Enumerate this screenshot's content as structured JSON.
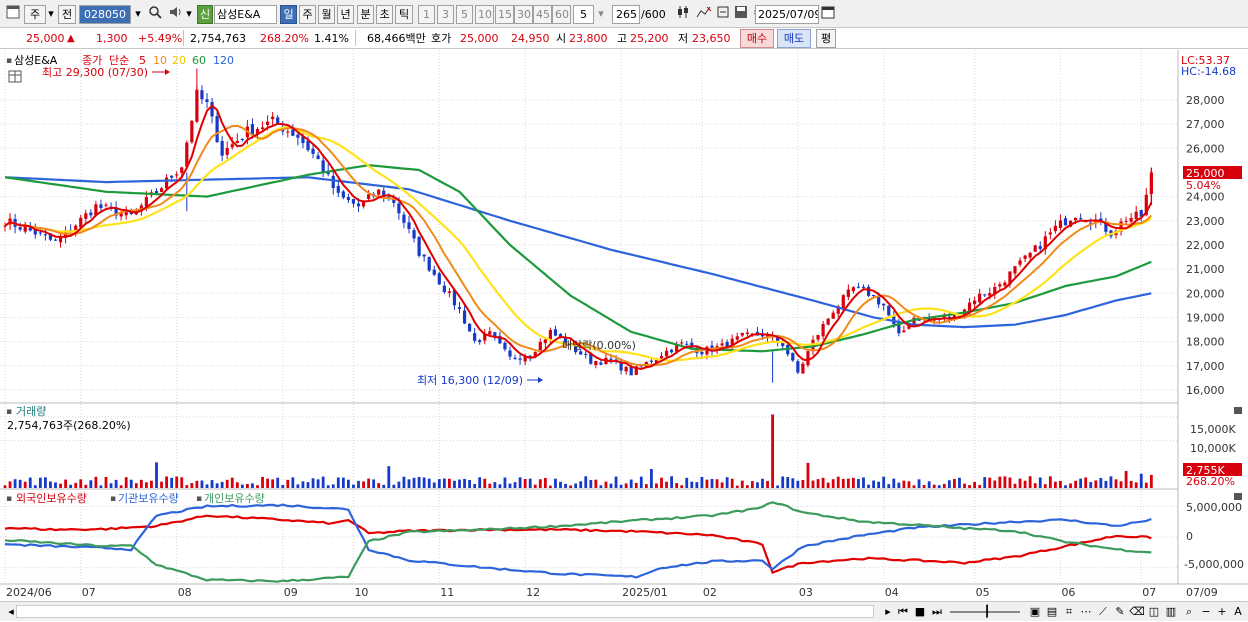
{
  "toolbar": {
    "period_select": "주",
    "prev_button": "전",
    "code": "028050",
    "new_badge": "신",
    "stock_name": "삼성E&A",
    "period_buttons": [
      "일",
      "주",
      "월",
      "년",
      "분",
      "초",
      "틱"
    ],
    "number_buttons": [
      "1",
      "3",
      "5",
      "10",
      "15",
      "30",
      "45",
      "60"
    ],
    "interval_value": "5",
    "count_value": "265",
    "count_max": "/600",
    "date_value": "2025/07/09"
  },
  "quote": {
    "price": "25,000",
    "change": "1,300",
    "change_pct": "+5.49%",
    "volume": "2,754,763",
    "volume_ratio": "268.20%",
    "turnover": "1.41%",
    "amount": "68,466백만",
    "ask_label": "호가",
    "ask": "25,000",
    "bid": "24,950",
    "open_label": "시",
    "open": "23,800",
    "high_label": "고",
    "high": "25,200",
    "low_label": "저",
    "low": "23,650",
    "buy_button": "매수",
    "sell_button": "매도",
    "eval_button": "평"
  },
  "colors": {
    "up": "#d8000d",
    "down": "#1539c8",
    "ma5": "#e00000",
    "ma10": "#f08a1c",
    "ma20": "#ffe21a",
    "ma60": "#1c9a3c",
    "ma120": "#2d64dc",
    "foreign": "#e00000",
    "institution": "#2d64dc",
    "individual": "#3c9a5c"
  },
  "chart_data": [
    {
      "type": "line",
      "panel": "price",
      "title": "삼성E&A",
      "legend": [
        "종가",
        "단순",
        "5",
        "10",
        "20",
        "60",
        "120"
      ],
      "high_annotation": "최고 29,300 (07/30)",
      "low_annotation": "최저 16,300 (12/09)",
      "dividend_annotation": "배당락(0.00%)",
      "lc_label": "LC:53.37",
      "hc_label": "HC:-14.68",
      "current_price_label": "25,000",
      "current_pct_label": "5.04%",
      "y_ticks": [
        "28,000",
        "27,000",
        "26,000",
        "24,000",
        "23,000",
        "22,000",
        "21,000",
        "20,000",
        "19,000",
        "18,000",
        "17,000",
        "16,000"
      ],
      "ylim": [
        15500,
        29900
      ],
      "x_labels": [
        "2024/06",
        "07",
        "08",
        "09",
        "10",
        "11",
        "12",
        "2025/01",
        "02",
        "03",
        "04",
        "05",
        "06",
        "07"
      ],
      "close_anchors": [
        [
          0,
          23000
        ],
        [
          6,
          22500
        ],
        [
          10,
          22100
        ],
        [
          18,
          23600
        ],
        [
          25,
          23200
        ],
        [
          30,
          24200
        ],
        [
          35,
          25300
        ],
        [
          38,
          28200
        ],
        [
          40,
          27800
        ],
        [
          43,
          25800
        ],
        [
          48,
          26700
        ],
        [
          53,
          27100
        ],
        [
          58,
          26500
        ],
        [
          62,
          25500
        ],
        [
          66,
          24000
        ],
        [
          70,
          23600
        ],
        [
          74,
          24200
        ],
        [
          77,
          23800
        ],
        [
          82,
          21700
        ],
        [
          86,
          20500
        ],
        [
          90,
          19300
        ],
        [
          93,
          18000
        ],
        [
          96,
          18300
        ],
        [
          100,
          17300
        ],
        [
          104,
          17500
        ],
        [
          108,
          18400
        ],
        [
          112,
          17800
        ],
        [
          116,
          17200
        ],
        [
          120,
          17200
        ],
        [
          124,
          16700
        ],
        [
          130,
          17500
        ],
        [
          134,
          17900
        ],
        [
          138,
          17600
        ],
        [
          142,
          17800
        ],
        [
          146,
          18200
        ],
        [
          150,
          18300
        ],
        [
          154,
          17900
        ],
        [
          157,
          16700
        ],
        [
          160,
          18000
        ],
        [
          164,
          19300
        ],
        [
          168,
          20200
        ],
        [
          171,
          20000
        ],
        [
          174,
          19500
        ],
        [
          177,
          18200
        ],
        [
          180,
          19000
        ],
        [
          184,
          18900
        ],
        [
          188,
          19000
        ],
        [
          192,
          19800
        ],
        [
          196,
          20200
        ],
        [
          200,
          21000
        ],
        [
          204,
          21800
        ],
        [
          208,
          22700
        ],
        [
          212,
          23300
        ],
        [
          216,
          23000
        ],
        [
          219,
          22500
        ],
        [
          222,
          23100
        ],
        [
          225,
          23200
        ],
        [
          226,
          24000
        ],
        [
          227,
          25000
        ]
      ],
      "ma": {
        "ma60": [
          [
            0,
            24800
          ],
          [
            20,
            24200
          ],
          [
            40,
            24000
          ],
          [
            60,
            24900
          ],
          [
            72,
            25300
          ],
          [
            82,
            25100
          ],
          [
            90,
            24200
          ],
          [
            100,
            22000
          ],
          [
            112,
            19900
          ],
          [
            124,
            18400
          ],
          [
            136,
            17700
          ],
          [
            150,
            17600
          ],
          [
            160,
            17800
          ],
          [
            170,
            18300
          ],
          [
            180,
            18900
          ],
          [
            190,
            19200
          ],
          [
            200,
            19600
          ],
          [
            210,
            20300
          ],
          [
            220,
            20700
          ],
          [
            227,
            21300
          ]
        ],
        "ma120": [
          [
            0,
            24800
          ],
          [
            20,
            24600
          ],
          [
            40,
            24700
          ],
          [
            60,
            24800
          ],
          [
            80,
            24300
          ],
          [
            100,
            23000
          ],
          [
            120,
            21800
          ],
          [
            140,
            20800
          ],
          [
            160,
            19700
          ],
          [
            172,
            19000
          ],
          [
            180,
            18700
          ],
          [
            190,
            18600
          ],
          [
            200,
            18700
          ],
          [
            210,
            19100
          ],
          [
            220,
            19700
          ],
          [
            227,
            20000
          ]
        ]
      },
      "volume_panel": {
        "title": "거래량",
        "value_label": "2,754,763주(268.20%)",
        "y_ticks": [
          "15,000K",
          "10,000K"
        ],
        "current_label": "2,755K",
        "current_pct": "268.20%",
        "ylim": [
          0,
          17500
        ],
        "spike_values": [
          [
            30,
            5400
          ],
          [
            76,
            4600
          ],
          [
            128,
            4000
          ],
          [
            152,
            15500
          ],
          [
            159,
            5300
          ],
          [
            222,
            3600
          ],
          [
            225,
            3000
          ],
          [
            227,
            2755
          ]
        ],
        "typical_range": [
          500,
          2500
        ]
      },
      "holdings_panel": {
        "legend": [
          "외국인보유수량",
          "기관보유수량",
          "개인보유수량"
        ],
        "y_ticks": [
          "5,000,000",
          "0",
          "-5,000,000"
        ],
        "ylim": [
          -7500000,
          7500000
        ],
        "foreign": [
          [
            0,
            1500000
          ],
          [
            10,
            1200000
          ],
          [
            20,
            1300000
          ],
          [
            30,
            1800000
          ],
          [
            40,
            3500000
          ],
          [
            55,
            2800000
          ],
          [
            65,
            2200000
          ],
          [
            68,
            2800000
          ],
          [
            72,
            600000
          ],
          [
            80,
            1000000
          ],
          [
            95,
            1200000
          ],
          [
            110,
            1200000
          ],
          [
            125,
            900000
          ],
          [
            140,
            300000
          ],
          [
            150,
            -1200000
          ],
          [
            152,
            -5700000
          ],
          [
            158,
            -4200000
          ],
          [
            170,
            -3500000
          ],
          [
            180,
            -3800000
          ],
          [
            190,
            -4200000
          ],
          [
            200,
            -3200000
          ],
          [
            210,
            -1500000
          ],
          [
            220,
            200000
          ],
          [
            227,
            -100000
          ]
        ],
        "institution": [
          [
            0,
            -1200000
          ],
          [
            10,
            -1500000
          ],
          [
            20,
            -1800000
          ],
          [
            25,
            -2000000
          ],
          [
            30,
            3500000
          ],
          [
            40,
            5000000
          ],
          [
            55,
            5200000
          ],
          [
            68,
            4500000
          ],
          [
            72,
            -2000000
          ],
          [
            80,
            -3800000
          ],
          [
            95,
            -5000000
          ],
          [
            110,
            -6000000
          ],
          [
            125,
            -6500000
          ],
          [
            130,
            -5000000
          ],
          [
            140,
            -4000000
          ],
          [
            150,
            -3800000
          ],
          [
            152,
            -5200000
          ],
          [
            158,
            -1500000
          ],
          [
            170,
            300000
          ],
          [
            180,
            1500000
          ],
          [
            190,
            2000000
          ],
          [
            200,
            2500000
          ],
          [
            210,
            2800000
          ],
          [
            220,
            1800000
          ],
          [
            227,
            2800000
          ]
        ],
        "individual": [
          [
            0,
            -500000
          ],
          [
            10,
            -1000000
          ],
          [
            20,
            -1500000
          ],
          [
            25,
            -1400000
          ],
          [
            30,
            -4500000
          ],
          [
            40,
            -7000000
          ],
          [
            55,
            -7200000
          ],
          [
            68,
            -6500000
          ],
          [
            72,
            -700000
          ],
          [
            80,
            800000
          ],
          [
            95,
            1200000
          ],
          [
            110,
            1800000
          ],
          [
            125,
            2700000
          ],
          [
            140,
            3500000
          ],
          [
            150,
            4800000
          ],
          [
            152,
            5800000
          ],
          [
            158,
            4000000
          ],
          [
            170,
            2500000
          ],
          [
            180,
            2000000
          ],
          [
            190,
            1400000
          ],
          [
            200,
            1000000
          ],
          [
            210,
            -800000
          ],
          [
            220,
            -2000000
          ],
          [
            227,
            -2500000
          ]
        ]
      }
    }
  ],
  "bottom_date": "07/09"
}
